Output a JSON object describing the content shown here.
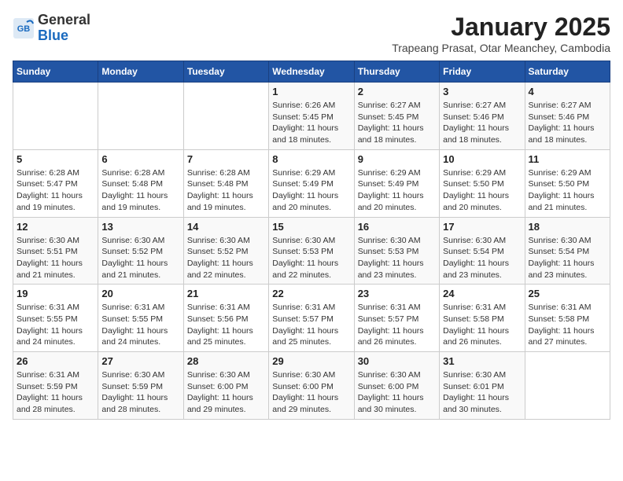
{
  "header": {
    "logo_general": "General",
    "logo_blue": "Blue",
    "month_title": "January 2025",
    "subtitle": "Trapeang Prasat, Otar Meanchey, Cambodia"
  },
  "weekdays": [
    "Sunday",
    "Monday",
    "Tuesday",
    "Wednesday",
    "Thursday",
    "Friday",
    "Saturday"
  ],
  "weeks": [
    [
      {
        "day": "",
        "sunrise": "",
        "sunset": "",
        "daylight": ""
      },
      {
        "day": "",
        "sunrise": "",
        "sunset": "",
        "daylight": ""
      },
      {
        "day": "",
        "sunrise": "",
        "sunset": "",
        "daylight": ""
      },
      {
        "day": "1",
        "sunrise": "Sunrise: 6:26 AM",
        "sunset": "Sunset: 5:45 PM",
        "daylight": "Daylight: 11 hours and 18 minutes."
      },
      {
        "day": "2",
        "sunrise": "Sunrise: 6:27 AM",
        "sunset": "Sunset: 5:45 PM",
        "daylight": "Daylight: 11 hours and 18 minutes."
      },
      {
        "day": "3",
        "sunrise": "Sunrise: 6:27 AM",
        "sunset": "Sunset: 5:46 PM",
        "daylight": "Daylight: 11 hours and 18 minutes."
      },
      {
        "day": "4",
        "sunrise": "Sunrise: 6:27 AM",
        "sunset": "Sunset: 5:46 PM",
        "daylight": "Daylight: 11 hours and 18 minutes."
      }
    ],
    [
      {
        "day": "5",
        "sunrise": "Sunrise: 6:28 AM",
        "sunset": "Sunset: 5:47 PM",
        "daylight": "Daylight: 11 hours and 19 minutes."
      },
      {
        "day": "6",
        "sunrise": "Sunrise: 6:28 AM",
        "sunset": "Sunset: 5:48 PM",
        "daylight": "Daylight: 11 hours and 19 minutes."
      },
      {
        "day": "7",
        "sunrise": "Sunrise: 6:28 AM",
        "sunset": "Sunset: 5:48 PM",
        "daylight": "Daylight: 11 hours and 19 minutes."
      },
      {
        "day": "8",
        "sunrise": "Sunrise: 6:29 AM",
        "sunset": "Sunset: 5:49 PM",
        "daylight": "Daylight: 11 hours and 20 minutes."
      },
      {
        "day": "9",
        "sunrise": "Sunrise: 6:29 AM",
        "sunset": "Sunset: 5:49 PM",
        "daylight": "Daylight: 11 hours and 20 minutes."
      },
      {
        "day": "10",
        "sunrise": "Sunrise: 6:29 AM",
        "sunset": "Sunset: 5:50 PM",
        "daylight": "Daylight: 11 hours and 20 minutes."
      },
      {
        "day": "11",
        "sunrise": "Sunrise: 6:29 AM",
        "sunset": "Sunset: 5:50 PM",
        "daylight": "Daylight: 11 hours and 21 minutes."
      }
    ],
    [
      {
        "day": "12",
        "sunrise": "Sunrise: 6:30 AM",
        "sunset": "Sunset: 5:51 PM",
        "daylight": "Daylight: 11 hours and 21 minutes."
      },
      {
        "day": "13",
        "sunrise": "Sunrise: 6:30 AM",
        "sunset": "Sunset: 5:52 PM",
        "daylight": "Daylight: 11 hours and 21 minutes."
      },
      {
        "day": "14",
        "sunrise": "Sunrise: 6:30 AM",
        "sunset": "Sunset: 5:52 PM",
        "daylight": "Daylight: 11 hours and 22 minutes."
      },
      {
        "day": "15",
        "sunrise": "Sunrise: 6:30 AM",
        "sunset": "Sunset: 5:53 PM",
        "daylight": "Daylight: 11 hours and 22 minutes."
      },
      {
        "day": "16",
        "sunrise": "Sunrise: 6:30 AM",
        "sunset": "Sunset: 5:53 PM",
        "daylight": "Daylight: 11 hours and 23 minutes."
      },
      {
        "day": "17",
        "sunrise": "Sunrise: 6:30 AM",
        "sunset": "Sunset: 5:54 PM",
        "daylight": "Daylight: 11 hours and 23 minutes."
      },
      {
        "day": "18",
        "sunrise": "Sunrise: 6:30 AM",
        "sunset": "Sunset: 5:54 PM",
        "daylight": "Daylight: 11 hours and 23 minutes."
      }
    ],
    [
      {
        "day": "19",
        "sunrise": "Sunrise: 6:31 AM",
        "sunset": "Sunset: 5:55 PM",
        "daylight": "Daylight: 11 hours and 24 minutes."
      },
      {
        "day": "20",
        "sunrise": "Sunrise: 6:31 AM",
        "sunset": "Sunset: 5:55 PM",
        "daylight": "Daylight: 11 hours and 24 minutes."
      },
      {
        "day": "21",
        "sunrise": "Sunrise: 6:31 AM",
        "sunset": "Sunset: 5:56 PM",
        "daylight": "Daylight: 11 hours and 25 minutes."
      },
      {
        "day": "22",
        "sunrise": "Sunrise: 6:31 AM",
        "sunset": "Sunset: 5:57 PM",
        "daylight": "Daylight: 11 hours and 25 minutes."
      },
      {
        "day": "23",
        "sunrise": "Sunrise: 6:31 AM",
        "sunset": "Sunset: 5:57 PM",
        "daylight": "Daylight: 11 hours and 26 minutes."
      },
      {
        "day": "24",
        "sunrise": "Sunrise: 6:31 AM",
        "sunset": "Sunset: 5:58 PM",
        "daylight": "Daylight: 11 hours and 26 minutes."
      },
      {
        "day": "25",
        "sunrise": "Sunrise: 6:31 AM",
        "sunset": "Sunset: 5:58 PM",
        "daylight": "Daylight: 11 hours and 27 minutes."
      }
    ],
    [
      {
        "day": "26",
        "sunrise": "Sunrise: 6:31 AM",
        "sunset": "Sunset: 5:59 PM",
        "daylight": "Daylight: 11 hours and 28 minutes."
      },
      {
        "day": "27",
        "sunrise": "Sunrise: 6:30 AM",
        "sunset": "Sunset: 5:59 PM",
        "daylight": "Daylight: 11 hours and 28 minutes."
      },
      {
        "day": "28",
        "sunrise": "Sunrise: 6:30 AM",
        "sunset": "Sunset: 6:00 PM",
        "daylight": "Daylight: 11 hours and 29 minutes."
      },
      {
        "day": "29",
        "sunrise": "Sunrise: 6:30 AM",
        "sunset": "Sunset: 6:00 PM",
        "daylight": "Daylight: 11 hours and 29 minutes."
      },
      {
        "day": "30",
        "sunrise": "Sunrise: 6:30 AM",
        "sunset": "Sunset: 6:00 PM",
        "daylight": "Daylight: 11 hours and 30 minutes."
      },
      {
        "day": "31",
        "sunrise": "Sunrise: 6:30 AM",
        "sunset": "Sunset: 6:01 PM",
        "daylight": "Daylight: 11 hours and 30 minutes."
      },
      {
        "day": "",
        "sunrise": "",
        "sunset": "",
        "daylight": ""
      }
    ]
  ]
}
